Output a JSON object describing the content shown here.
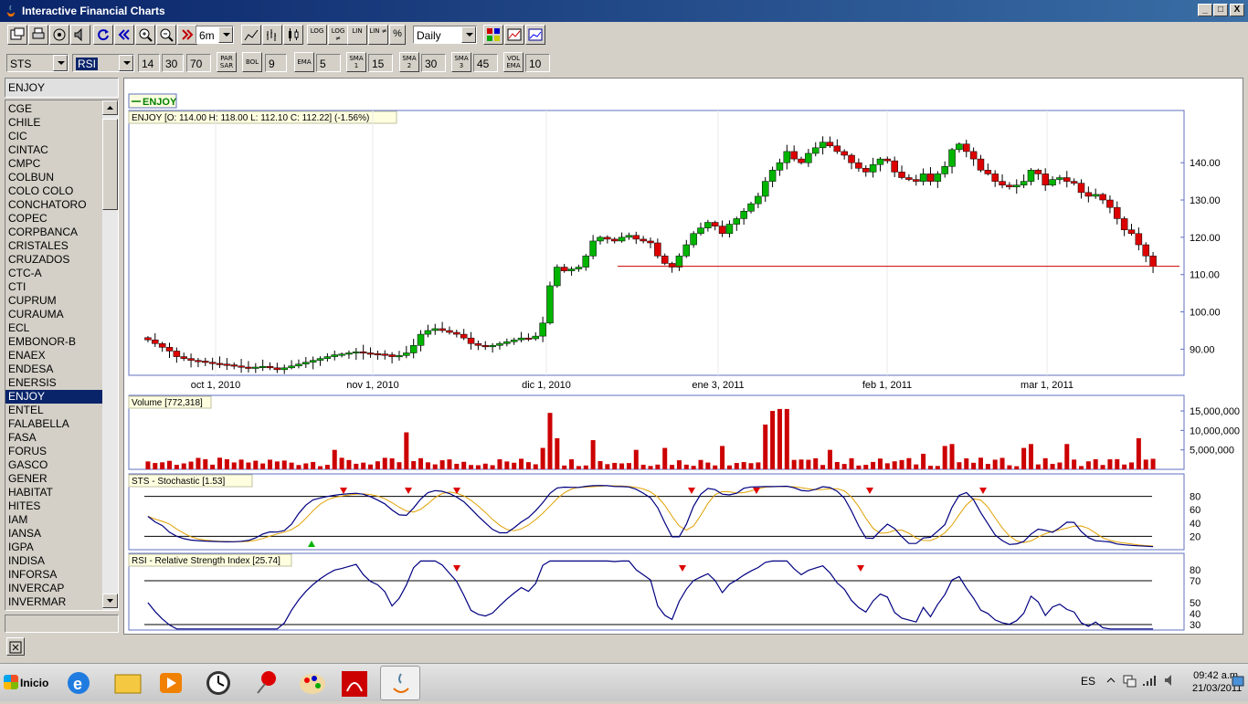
{
  "window": {
    "title": "Interactive Financial Charts",
    "buttons": [
      "_",
      "□",
      "X"
    ]
  },
  "toolbar": {
    "period": "6m",
    "interval": "Daily",
    "scale_buttons": [
      "LOG",
      "LOG ≠",
      "LIN",
      "LIN ≠",
      "%"
    ]
  },
  "indicators": {
    "osc1": "STS",
    "osc2": "RSI",
    "rsi_period": "14",
    "rsi_low": "30",
    "rsi_high": "70",
    "par_sar": "PAR SAR",
    "bol": "BOL",
    "bol_value": "9",
    "ema": "EMA",
    "ema_value": "5",
    "sma1": "SMA 1",
    "sma1_value": "15",
    "sma2": "SMA 2",
    "sma2_value": "30",
    "sma3": "SMA 3",
    "sma3_value": "45",
    "vol_ema": "VOL EMA",
    "vol_ema_value": "10"
  },
  "symbols": {
    "selected": "ENJOY",
    "list": [
      "CGE",
      "CHILE",
      "CIC",
      "CINTAC",
      "CMPC",
      "COLBUN",
      "COLO COLO",
      "CONCHATORO",
      "COPEC",
      "CORPBANCA",
      "CRISTALES",
      "CRUZADOS",
      "CTC-A",
      "CTI",
      "CUPRUM",
      "CURAUMA",
      "ECL",
      "EMBONOR-B",
      "ENAEX",
      "ENDESA",
      "ENERSIS",
      "ENJOY",
      "ENTEL",
      "FALABELLA",
      "FASA",
      "FORUS",
      "GASCO",
      "GENER",
      "HABITAT",
      "HITES",
      "IAM",
      "IANSA",
      "IGPA",
      "INDISA",
      "INFORSA",
      "INVERCAP",
      "INVERMAR"
    ]
  },
  "chart_data": [
    {
      "type": "candlestick",
      "legend": "ENJOY",
      "info": "ENJOY [O: 114.00  H: 118.00  L: 112.10  C: 112.22] (-1.56%)",
      "x_ticks": [
        "oct 1, 2010",
        "nov 1, 2010",
        "dic 1, 2010",
        "ene 3, 2011",
        "feb 1, 2011",
        "mar 1, 2011"
      ],
      "y_ticks": [
        "140.00",
        "130.00",
        "120.00",
        "110.00",
        "100.00",
        "90.00"
      ],
      "ylim": [
        83,
        154
      ],
      "closes": [
        92.5,
        91.5,
        90.5,
        89.5,
        88.0,
        87.5,
        87.0,
        86.8,
        86.5,
        86.2,
        86.0,
        85.8,
        85.5,
        85.2,
        85.0,
        85.2,
        85.4,
        85.0,
        84.5,
        85.0,
        85.5,
        86.0,
        86.5,
        87.0,
        87.5,
        88.0,
        88.5,
        88.7,
        89.0,
        89.3,
        89.0,
        88.8,
        88.7,
        88.5,
        88.0,
        88.3,
        89.0,
        91.0,
        94.0,
        95.0,
        95.5,
        95.0,
        94.5,
        94.0,
        93.0,
        91.5,
        91.0,
        90.8,
        91.0,
        91.5,
        92.0,
        92.5,
        93.0,
        92.8,
        93.5,
        97.0,
        107.0,
        112.0,
        111.0,
        111.5,
        112.0,
        115.0,
        119.0,
        120.0,
        119.5,
        119.0,
        120.0,
        120.5,
        119.5,
        119.0,
        118.5,
        115.0,
        113.0,
        112.0,
        115.0,
        118.0,
        121.0,
        122.5,
        124.0,
        123.0,
        121.0,
        123.5,
        125.0,
        127.0,
        129.0,
        131.0,
        135.0,
        138.0,
        140.0,
        143.0,
        141.0,
        140.0,
        142.5,
        144.0,
        145.5,
        144.5,
        143.0,
        142.0,
        140.0,
        138.5,
        137.5,
        139.5,
        141.0,
        140.5,
        137.5,
        136.0,
        135.5,
        135.0,
        137.0,
        135.0,
        137.0,
        139.0,
        143.5,
        145.0,
        143.0,
        141.0,
        138.0,
        137.0,
        135.0,
        134.0,
        133.5,
        134.0,
        135.0,
        138.0,
        137.0,
        134.0,
        135.5,
        136.0,
        135.0,
        134.5,
        132.0,
        131.0,
        131.5,
        130.0,
        128.0,
        125.0,
        122.0,
        121.0,
        118.0,
        115.0,
        112.22
      ],
      "reference_line": 112.22
    },
    {
      "type": "bar",
      "info": "Volume [772,318]",
      "y_ticks": [
        "15,000,000",
        "10,000,000",
        "5,000,000"
      ],
      "ylim": [
        0,
        19000000
      ]
    },
    {
      "type": "line",
      "info": "STS - Stochastic [1.53]",
      "y_ticks": [
        "80",
        "60",
        "40",
        "20"
      ],
      "ylim": [
        0,
        100
      ],
      "levels": [
        80,
        20
      ]
    },
    {
      "type": "line",
      "info": "RSI - Relative Strength Index [25.74]",
      "y_ticks": [
        "80",
        "70",
        "50",
        "40",
        "30"
      ],
      "ylim": [
        25,
        90
      ],
      "levels": [
        70,
        30
      ]
    }
  ],
  "taskbar": {
    "start": "Inicio",
    "lang": "ES",
    "time": "09:42 a.m.",
    "date": "21/03/2011"
  },
  "colors": {
    "up": "#00b400",
    "down": "#dd0000",
    "sto_k": "#000080",
    "sto_d": "#e0a000"
  }
}
